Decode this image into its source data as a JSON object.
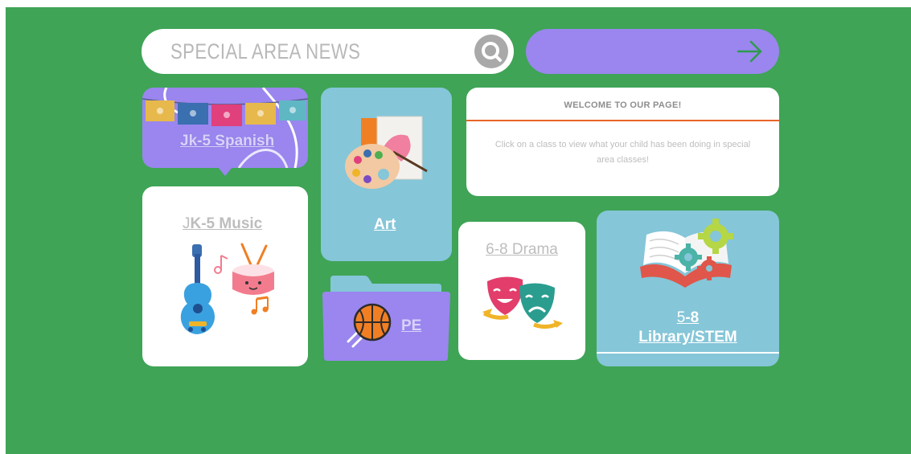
{
  "search": {
    "placeholder": "SPECIAL AREA NEWS"
  },
  "welcome": {
    "title": "WELCOME TO OUR PAGE!",
    "body": "Click on a class to view what your child has been doing in special area classes!"
  },
  "classes": {
    "spanish": "Jk-5 Spanish",
    "music_prefix": "J",
    "music_rest": "K-5 Music",
    "art": "Art",
    "pe": "PE",
    "drama": "6-8 Drama",
    "library_line1_prefix": "5",
    "library_line1_rest": "-8",
    "library_line2": "Library/STEM"
  },
  "colors": {
    "background": "#3fa456",
    "purple": "#9a86ee",
    "light_blue": "#85c6d8",
    "white": "#ffffff",
    "accent_line": "#e8642a"
  },
  "icons": [
    "search-icon",
    "arrow-right-icon",
    "papel-picado-banner-icon",
    "guitar-icon",
    "drum-icon",
    "music-note-icon",
    "paint-palette-icon",
    "basketball-icon",
    "folder-icon",
    "theater-masks-icon",
    "open-book-icon",
    "gears-icon"
  ]
}
